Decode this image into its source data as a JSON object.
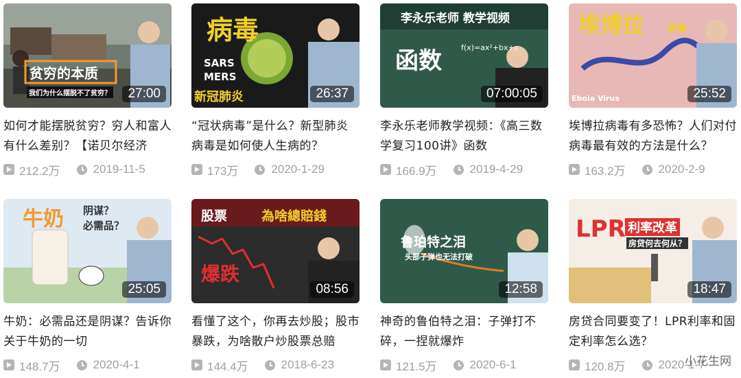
{
  "videos": [
    {
      "title": "如何才能摆脱贫穷？穷人和富人有什么差别？【诺贝尔经济",
      "duration": "27:00",
      "views": "212.2万",
      "date": "2019-11-5",
      "overlay": [
        "贫穷的本质",
        "我们为什么摆脱不了贫穷？"
      ]
    },
    {
      "title": "“冠状病毒”是什么？新型肺炎病毒是如何使人生病的？",
      "duration": "26:37",
      "views": "173万",
      "date": "2020-1-29",
      "overlay": [
        "病毒",
        "SARS",
        "MERS",
        "新冠肺炎"
      ]
    },
    {
      "title": "李永乐老师教学视频：《高三数学复习100讲》函数",
      "duration": "07:00:05",
      "views": "166.9万",
      "date": "2019-4-29",
      "overlay": [
        "李永乐老师 教学视频",
        "函数",
        "f(x)=ax²+bx+c"
      ]
    },
    {
      "title": "埃博拉病毒有多恐怖？人们对付病毒最有效的方法是什么？",
      "duration": "25:52",
      "views": "163.2万",
      "date": "2020-2-9",
      "overlay": [
        "埃博拉",
        "病毒",
        "Ebola Virus"
      ]
    },
    {
      "title": "牛奶：必需品还是阴谋？告诉你关于牛奶的一切",
      "duration": "25:05",
      "views": "148.7万",
      "date": "2020-4-1",
      "overlay": [
        "牛奶",
        "阴谋？",
        "必需品？"
      ]
    },
    {
      "title": "看懂了这个，你再去炒股；股市暴跌，为啥散户炒股票总赔",
      "duration": "08:56",
      "views": "144.4万",
      "date": "2018-6-23",
      "overlay": [
        "股票",
        "為啥總賠錢",
        "爆跌"
      ]
    },
    {
      "title": "神奇的鲁伯特之泪：子弹打不碎，一捏就爆炸",
      "duration": "12:58",
      "views": "121.5万",
      "date": "2020-6-1",
      "overlay": [
        "鲁珀特之泪",
        "头部子弹也无法打破"
      ]
    },
    {
      "title": "房贷合同要变了！LPR利率和固定利率怎么选？",
      "duration": "18:47",
      "views": "120.8万",
      "date": "2020-1-7",
      "overlay": [
        "LPR",
        "利率改革",
        "房贷何去何从？"
      ]
    }
  ],
  "watermark": "小花生网"
}
